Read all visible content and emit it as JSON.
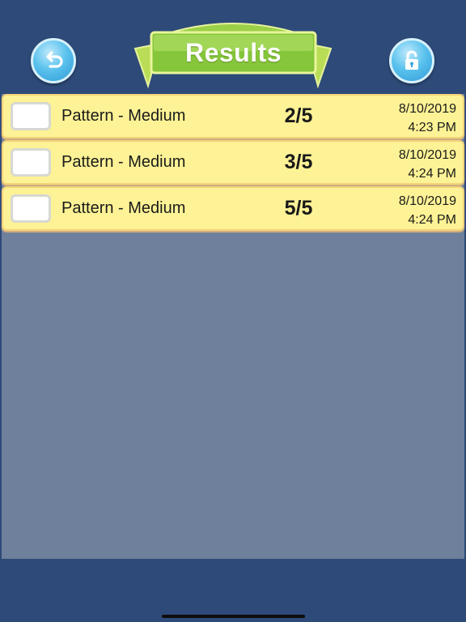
{
  "header": {
    "title": "Results",
    "back_icon": "back-arrow-icon",
    "lock_icon": "unlock-icon"
  },
  "results": [
    {
      "name": "Pattern - Medium",
      "score": "2/5",
      "date": "8/10/2019",
      "time": "4:23 PM"
    },
    {
      "name": "Pattern - Medium",
      "score": "3/5",
      "date": "8/10/2019",
      "time": "4:24 PM"
    },
    {
      "name": "Pattern - Medium",
      "score": "5/5",
      "date": "8/10/2019",
      "time": "4:24 PM"
    }
  ],
  "colors": {
    "background": "#2e4a78",
    "panel": "#6e809b",
    "row": "#fdf295",
    "banner_green": "#86c63a",
    "button_blue": "#4db8ea"
  }
}
